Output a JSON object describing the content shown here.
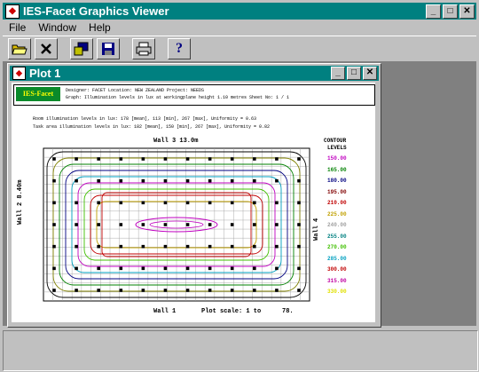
{
  "app": {
    "title": "IES-Facet Graphics Viewer",
    "minimize": "_",
    "maximize": "□",
    "close": "✕"
  },
  "menu": {
    "file": "File",
    "window": "Window",
    "help": "Help"
  },
  "toolbar": {
    "icons": [
      "open-folder-icon",
      "delete-icon",
      "export-icon",
      "save-icon",
      "print-icon",
      "help-icon"
    ],
    "help_glyph": "?"
  },
  "plot": {
    "title": "Plot 1",
    "logo": "IES-Facet",
    "header": {
      "line1": "Designer: FACET   Location: NEW ZEALAND                          Project: NEEDS",
      "line2": "Graph: Illumination levels in lux at workingplane height 1.10 metres      Sheet No: 1 / 1",
      "note1": "Room illumination levels in lux:  178 [mean],  113 [min],  267 [max], Uniformity = 0.63",
      "note2": "Task area illumination levels in lux:  182 [mean],  150 [min],  267 [max], Uniformity = 0.82"
    },
    "wall_top": "Wall 3  13.0m",
    "wall_bottom": "Wall 1",
    "wall_left": "Wall 2  8.40m",
    "wall_right": "Wall 4",
    "scale_label": "Plot scale: 1 to",
    "scale_value": "78.",
    "contour_title": "CONTOUR",
    "contour_subtitle": "LEVELS",
    "contours": [
      {
        "value": "150.00",
        "color": "#c000c0"
      },
      {
        "value": "165.00",
        "color": "#008000"
      },
      {
        "value": "180.00",
        "color": "#000080"
      },
      {
        "value": "195.00",
        "color": "#800000"
      },
      {
        "value": "210.00",
        "color": "#c00000"
      },
      {
        "value": "225.00",
        "color": "#c0a000"
      },
      {
        "value": "240.00",
        "color": "#a0a0a0"
      },
      {
        "value": "255.00",
        "color": "#008080"
      },
      {
        "value": "270.00",
        "color": "#40c000"
      },
      {
        "value": "285.00",
        "color": "#00a0c0"
      },
      {
        "value": "300.00",
        "color": "#c00000"
      },
      {
        "value": "315.00",
        "color": "#c000a0"
      },
      {
        "value": "330.00",
        "color": "#e0e000"
      }
    ]
  }
}
